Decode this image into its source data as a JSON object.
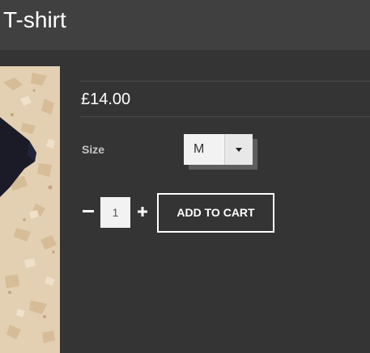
{
  "header": {
    "title": "T-shirt"
  },
  "product": {
    "image_icon": "product-photo-tshirt-on-osb-board",
    "price": "£14.00",
    "size_label": "Size",
    "size_selected": "M",
    "size_dropdown_icon": "caret-down-icon",
    "quantity": "1",
    "qty_minus_icon": "minus-icon",
    "qty_plus_icon": "plus-icon",
    "add_to_cart_label": "ADD TO CART"
  },
  "colors": {
    "background": "#343434",
    "header_bar": "#404040",
    "accent_text": "#ffffff"
  }
}
